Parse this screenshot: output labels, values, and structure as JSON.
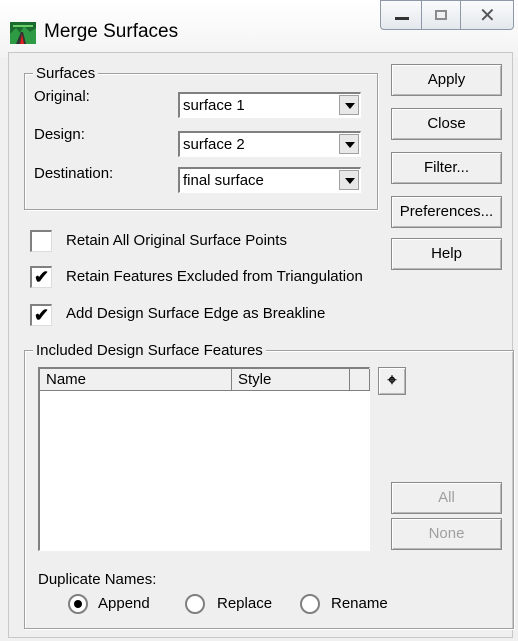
{
  "window": {
    "title": "Merge Surfaces",
    "app_icon": "surface-landscape-icon"
  },
  "window_controls": {
    "minimize_icon": "minimize-icon",
    "maximize_icon": "maximize-icon",
    "close_icon": "close-icon"
  },
  "surfaces_group": {
    "legend": "Surfaces",
    "original": {
      "label": "Original:",
      "value": "surface 1"
    },
    "design": {
      "label": "Design:",
      "value": "surface 2"
    },
    "destination": {
      "label": "Destination:",
      "value": "final surface"
    }
  },
  "buttons": {
    "apply": "Apply",
    "close": "Close",
    "filter": "Filter...",
    "preferences": "Preferences...",
    "help": "Help",
    "all": "All",
    "none": "None"
  },
  "options": {
    "retain_all": {
      "label": "Retain All Original Surface Points",
      "checked": false
    },
    "retain_features": {
      "label": "Retain Features Excluded from Triangulation",
      "checked": true
    },
    "add_edge": {
      "label": "Add Design Surface Edge as Breakline",
      "checked": true
    }
  },
  "features_group": {
    "legend": "Included Design Surface Features",
    "columns": [
      "Name",
      "Style",
      ""
    ],
    "rows": [],
    "picker_icon": "crosshair-pick-icon"
  },
  "duplicate_names": {
    "label": "Duplicate Names:",
    "options": [
      {
        "label": "Append",
        "selected": true
      },
      {
        "label": "Replace",
        "selected": false
      },
      {
        "label": "Rename",
        "selected": false
      }
    ]
  },
  "check_mark": "✔"
}
